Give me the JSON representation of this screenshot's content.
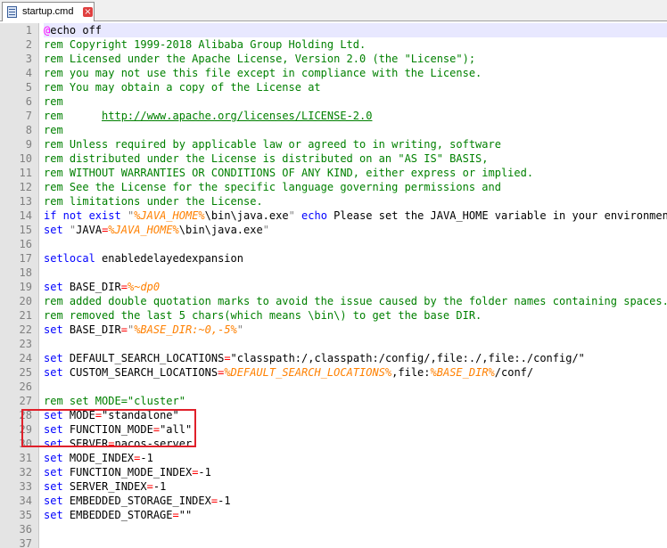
{
  "tab": {
    "title": "startup.cmd",
    "icon": "file-icon",
    "close_icon": "close-icon",
    "close_glyph": "×"
  },
  "colors": {
    "comment": "#008000",
    "keyword": "#0000ff",
    "variable": "#ff8000",
    "string": "#808080",
    "operator": "#ff0000",
    "label": "#ff00ff",
    "gutter": "#e4e4e4",
    "current_line": "#e8e8ff",
    "highlight_box": "#e0202a"
  },
  "editor": {
    "current_line": 1,
    "highlight_lines": [
      27,
      28
    ],
    "lines": [
      [
        [
          "label",
          "@"
        ],
        [
          "plain",
          "echo off"
        ]
      ],
      [
        [
          "comment",
          "rem Copyright 1999-2018 Alibaba Group Holding Ltd."
        ]
      ],
      [
        [
          "comment",
          "rem Licensed under the Apache License, Version 2.0 (the \"License\");"
        ]
      ],
      [
        [
          "comment",
          "rem you may not use this file except in compliance with the License."
        ]
      ],
      [
        [
          "comment",
          "rem You may obtain a copy of the License at"
        ]
      ],
      [
        [
          "comment",
          "rem"
        ]
      ],
      [
        [
          "comment",
          "rem      "
        ],
        [
          "link",
          "http://www.apache.org/licenses/LICENSE-2.0"
        ]
      ],
      [
        [
          "comment",
          "rem"
        ]
      ],
      [
        [
          "comment",
          "rem Unless required by applicable law or agreed to in writing, software"
        ]
      ],
      [
        [
          "comment",
          "rem distributed under the License is distributed on an \"AS IS\" BASIS,"
        ]
      ],
      [
        [
          "comment",
          "rem WITHOUT WARRANTIES OR CONDITIONS OF ANY KIND, either express or implied."
        ]
      ],
      [
        [
          "comment",
          "rem See the License for the specific language governing permissions and"
        ]
      ],
      [
        [
          "comment",
          "rem limitations under the License."
        ]
      ],
      [
        [
          "keyword",
          "if not exist"
        ],
        [
          "plain",
          " "
        ],
        [
          "string",
          "\""
        ],
        [
          "variable",
          "%JAVA_HOME%"
        ],
        [
          "plain",
          "\\bin\\java.exe"
        ],
        [
          "string",
          "\""
        ],
        [
          "plain",
          " "
        ],
        [
          "keyword",
          "echo"
        ],
        [
          "plain",
          " Please set the JAVA_HOME variable in your environment,"
        ]
      ],
      [
        [
          "keyword",
          "set"
        ],
        [
          "plain",
          " "
        ],
        [
          "string",
          "\""
        ],
        [
          "plain",
          "JAVA"
        ],
        [
          "operator",
          "="
        ],
        [
          "variable",
          "%JAVA_HOME%"
        ],
        [
          "plain",
          "\\bin\\java.exe"
        ],
        [
          "string",
          "\""
        ]
      ],
      [],
      [
        [
          "keyword",
          "setlocal"
        ],
        [
          "plain",
          " enabledelayedexpansion"
        ]
      ],
      [],
      [
        [
          "keyword",
          "set"
        ],
        [
          "plain",
          " BASE_DIR"
        ],
        [
          "operator",
          "="
        ],
        [
          "variable",
          "%~dp0"
        ]
      ],
      [
        [
          "comment",
          "rem added double quotation marks to avoid the issue caused by the folder names containing spaces."
        ]
      ],
      [
        [
          "comment",
          "rem removed the last 5 chars(which means \\bin\\) to get the base DIR."
        ]
      ],
      [
        [
          "keyword",
          "set"
        ],
        [
          "plain",
          " BASE_DIR"
        ],
        [
          "operator",
          "="
        ],
        [
          "string",
          "\""
        ],
        [
          "variable",
          "%BASE_DIR:~0,-5%"
        ],
        [
          "string",
          "\""
        ]
      ],
      [],
      [
        [
          "keyword",
          "set"
        ],
        [
          "plain",
          " DEFAULT_SEARCH_LOCATIONS"
        ],
        [
          "operator",
          "="
        ],
        [
          "plain",
          "\"classpath:/,classpath:/config/,file:./,file:./config/\""
        ]
      ],
      [
        [
          "keyword",
          "set"
        ],
        [
          "plain",
          " CUSTOM_SEARCH_LOCATIONS"
        ],
        [
          "operator",
          "="
        ],
        [
          "variable",
          "%DEFAULT_SEARCH_LOCATIONS%"
        ],
        [
          "plain",
          ",file:"
        ],
        [
          "variable",
          "%BASE_DIR%"
        ],
        [
          "plain",
          "/conf/"
        ]
      ],
      [],
      [
        [
          "comment",
          "rem set MODE=\"cluster\""
        ]
      ],
      [
        [
          "keyword",
          "set"
        ],
        [
          "plain",
          " MODE"
        ],
        [
          "operator",
          "="
        ],
        [
          "plain",
          "\"standalone\""
        ]
      ],
      [
        [
          "keyword",
          "set"
        ],
        [
          "plain",
          " FUNCTION_MODE"
        ],
        [
          "operator",
          "="
        ],
        [
          "plain",
          "\"all\""
        ]
      ],
      [
        [
          "keyword",
          "set"
        ],
        [
          "plain",
          " SERVER"
        ],
        [
          "operator",
          "="
        ],
        [
          "plain",
          "nacos-server"
        ]
      ],
      [
        [
          "keyword",
          "set"
        ],
        [
          "plain",
          " MODE_INDEX"
        ],
        [
          "operator",
          "="
        ],
        [
          "plain",
          "-1"
        ]
      ],
      [
        [
          "keyword",
          "set"
        ],
        [
          "plain",
          " FUNCTION_MODE_INDEX"
        ],
        [
          "operator",
          "="
        ],
        [
          "plain",
          "-1"
        ]
      ],
      [
        [
          "keyword",
          "set"
        ],
        [
          "plain",
          " SERVER_INDEX"
        ],
        [
          "operator",
          "="
        ],
        [
          "plain",
          "-1"
        ]
      ],
      [
        [
          "keyword",
          "set"
        ],
        [
          "plain",
          " EMBEDDED_STORAGE_INDEX"
        ],
        [
          "operator",
          "="
        ],
        [
          "plain",
          "-1"
        ]
      ],
      [
        [
          "keyword",
          "set"
        ],
        [
          "plain",
          " EMBEDDED_STORAGE"
        ],
        [
          "operator",
          "="
        ],
        [
          "plain",
          "\"\""
        ]
      ],
      [],
      []
    ]
  }
}
